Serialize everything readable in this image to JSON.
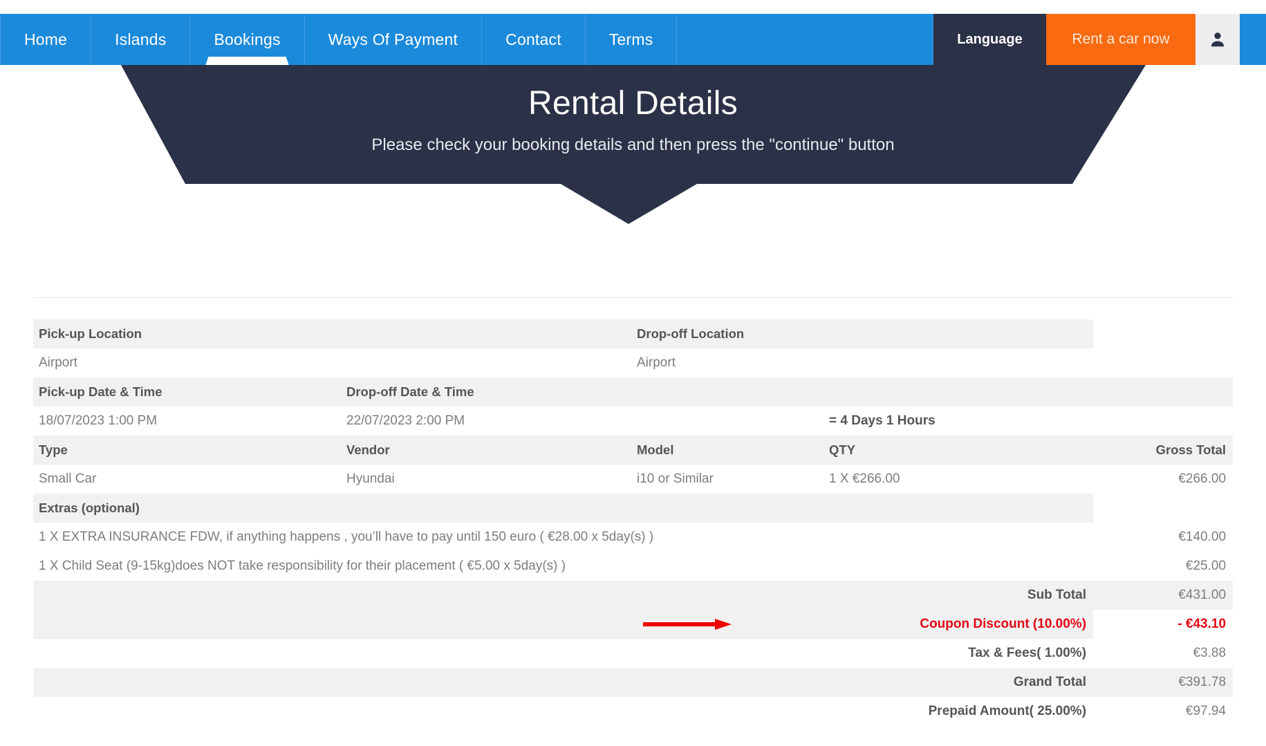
{
  "navbar": {
    "items": [
      {
        "label": "Home",
        "active": false
      },
      {
        "label": "Islands",
        "active": false
      },
      {
        "label": "Bookings",
        "active": true
      },
      {
        "label": "Ways Of Payment",
        "active": false
      },
      {
        "label": "Contact",
        "active": false
      },
      {
        "label": "Terms",
        "active": false
      }
    ],
    "language_label": "Language",
    "rent_label": "Rent a car now",
    "user_icon": "user-icon",
    "colors": {
      "nav_bg": "#1c8adb",
      "language_bg": "#2b3147",
      "rent_bg": "#f96a11",
      "user_bg": "#eeeeee"
    }
  },
  "banner": {
    "title": "Rental Details",
    "subtitle": "Please check your booking details and then press the \"continue\" button",
    "bg_color": "#2b3147"
  },
  "booking": {
    "pickup_location_label": "Pick-up Location",
    "dropoff_location_label": "Drop-off Location",
    "pickup_location_value": "Airport",
    "dropoff_location_value": "Airport",
    "pickup_datetime_label": "Pick-up Date & Time",
    "dropoff_datetime_label": "Drop-off Date & Time",
    "pickup_datetime_value": "18/07/2023   1:00 PM",
    "dropoff_datetime_value": "22/07/2023   2:00 PM",
    "duration_value": "= 4 Days 1 Hours",
    "type_label": "Type",
    "vendor_label": "Vendor",
    "model_label": "Model",
    "qty_label": "QTY",
    "gross_total_label": "Gross Total",
    "type_value": "Small Car",
    "vendor_value": "Hyundai",
    "model_value": "i10 or Similar",
    "qty_value": "1 X €266.00",
    "gross_total_value": "€266.00",
    "extras_label": "Extras (optional)",
    "extras": [
      {
        "description": "1 X EXTRA INSURANCE FDW, if anything happens , you’ll have to pay until 150 euro ( €28.00 x 5day(s) )",
        "amount": "€140.00"
      },
      {
        "description": "1 X Child Seat (9-15kg)does NOT take responsibility for their placement ( €5.00 x 5day(s) )",
        "amount": "€25.00"
      }
    ],
    "totals": [
      {
        "label": "Sub Total",
        "value": "€431.00"
      },
      {
        "label": "Coupon Discount (10.00%)",
        "value": "- €43.10"
      },
      {
        "label": "Tax & Fees( 1.00%)",
        "value": "€3.88"
      },
      {
        "label": "Grand Total",
        "value": "€391.78"
      },
      {
        "label": "Prepaid Amount( 25.00%)",
        "value": "€97.94"
      }
    ],
    "annotation_color": "#e30613"
  }
}
